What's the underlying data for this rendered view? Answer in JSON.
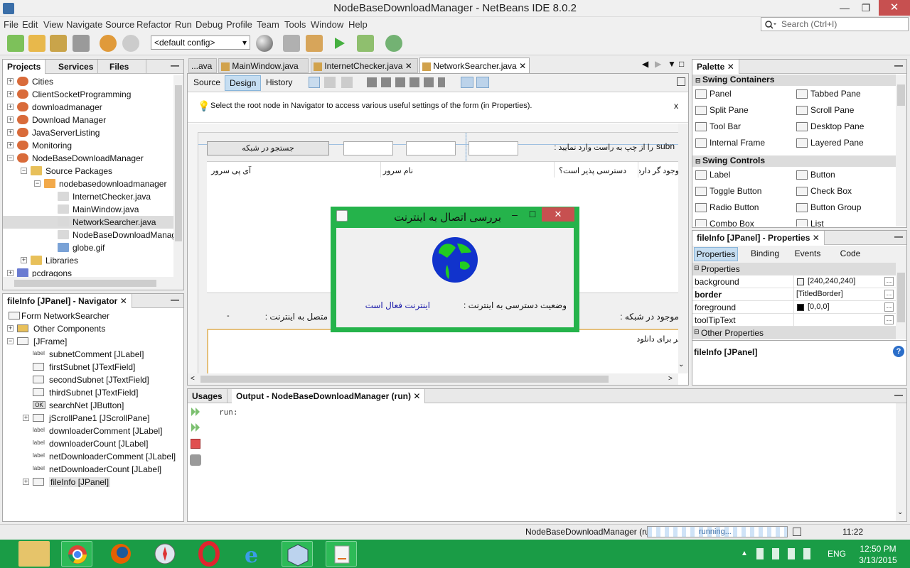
{
  "window": {
    "title": "NodeBaseDownloadManager - NetBeans IDE 8.0.2",
    "minimize": "—",
    "maximize": "❐",
    "close": "✕"
  },
  "menu": [
    "File",
    "Edit",
    "View",
    "Navigate",
    "Source",
    "Refactor",
    "Run",
    "Debug",
    "Profile",
    "Team",
    "Tools",
    "Window",
    "Help"
  ],
  "search": {
    "placeholder": "Search (Ctrl+I)"
  },
  "toolbar": {
    "config": "<default config>"
  },
  "projects": {
    "tabs": [
      "Projects",
      "Services",
      "Files"
    ],
    "items": [
      {
        "label": "Cities"
      },
      {
        "label": "ClientSocketProgramming"
      },
      {
        "label": "downloadmanager"
      },
      {
        "label": "Download Manager"
      },
      {
        "label": "JavaServerListing"
      },
      {
        "label": "Monitoring"
      },
      {
        "label": "NodeBaseDownloadManager"
      },
      {
        "label": "Source Packages"
      },
      {
        "label": "nodebasedownloadmanager"
      },
      {
        "label": "InternetChecker.java"
      },
      {
        "label": "MainWindow.java"
      },
      {
        "label": "NetworkSearcher.java"
      },
      {
        "label": "NodeBaseDownloadManager"
      },
      {
        "label": "globe.gif"
      },
      {
        "label": "Libraries"
      },
      {
        "label": "pcdragons"
      }
    ]
  },
  "navigator": {
    "title": "fileInfo [JPanel] - Navigator",
    "items": [
      {
        "label": "Form NetworkSearcher"
      },
      {
        "label": "Other Components"
      },
      {
        "label": "[JFrame]"
      },
      {
        "label": "subnetComment [JLabel]"
      },
      {
        "label": "firstSubnet [JTextField]"
      },
      {
        "label": "secondSubnet [JTextField]"
      },
      {
        "label": "thirdSubnet [JTextField]"
      },
      {
        "label": "searchNet [JButton]"
      },
      {
        "label": "jScrollPane1 [JScrollPane]"
      },
      {
        "label": "downloaderComment [JLabel]"
      },
      {
        "label": "downloaderCount [JLabel]"
      },
      {
        "label": "netDownloaderComment [JLabel]"
      },
      {
        "label": "netDownloaderCount [JLabel]"
      },
      {
        "label": "fileInfo [JPanel]"
      }
    ],
    "icon_labels": {
      "label": "label",
      "ok": "OK"
    }
  },
  "editor": {
    "tabs": [
      "...ava",
      "MainWindow.java",
      "InternetChecker.java",
      "NetworkSearcher.java"
    ],
    "subtabs": [
      "Source",
      "Design",
      "History"
    ],
    "hint": "Select the root node in Navigator to access various useful settings of the form (in Properties).",
    "hint_close": "x"
  },
  "form": {
    "search_button": "جستجو در شبکه",
    "subnet_label": "subn",
    "subnet_comment": "را از چپ به راست وارد نمایید :",
    "col_ip": "آی پی سرور",
    "col_name": "نام سرور",
    "col_access": "دسترسی پذیر است؟",
    "col_exists": "وجود گر دارد؟",
    "net_count": "موجود در شبکه :",
    "connected": "متصل به اینترنت :",
    "dash": "-",
    "download_label": "لر برای دانلود"
  },
  "dialog": {
    "title": "بررسی اتصال به اینترنت",
    "status_label": "وضعیت دسترسی به اینترنت :",
    "status_value": "اینترنت فعال است",
    "min": "–",
    "max": "□",
    "close": "✕"
  },
  "palette": {
    "title": "Palette",
    "sections": [
      {
        "name": "Swing Containers",
        "items": [
          "Panel",
          "Tabbed Pane",
          "Split Pane",
          "Scroll Pane",
          "Tool Bar",
          "Desktop Pane",
          "Internal Frame",
          "Layered Pane"
        ]
      },
      {
        "name": "Swing Controls",
        "items": [
          "Label",
          "Button",
          "Toggle Button",
          "Check Box",
          "Radio Button",
          "Button Group",
          "Combo Box",
          "List"
        ]
      }
    ]
  },
  "properties": {
    "title": "fileInfo [JPanel] - Properties",
    "tabs": [
      "Properties",
      "Binding",
      "Events",
      "Code"
    ],
    "section": "Properties",
    "rows": [
      {
        "name": "background",
        "value": "[240,240,240]",
        "bold": false
      },
      {
        "name": "border",
        "value": "[TitledBorder]",
        "bold": true
      },
      {
        "name": "foreground",
        "value": "[0,0,0]",
        "bold": false
      },
      {
        "name": "toolTipText",
        "value": "",
        "bold": false
      }
    ],
    "other": "Other Properties",
    "footer": "fileInfo [JPanel]"
  },
  "output": {
    "tabs": [
      "Usages",
      "Output - NodeBaseDownloadManager (run)"
    ],
    "text": "run:"
  },
  "status": {
    "project": "NodeBaseDownloadManager (run)",
    "progress": "running...",
    "time": "11:22"
  },
  "taskbar": {
    "lang": "ENG",
    "clock": "12:50 PM",
    "date": "3/13/2015"
  },
  "colors": {
    "dialog_border": "#25b34b",
    "taskbar": "#1a9c46",
    "accent": "#c75050"
  }
}
